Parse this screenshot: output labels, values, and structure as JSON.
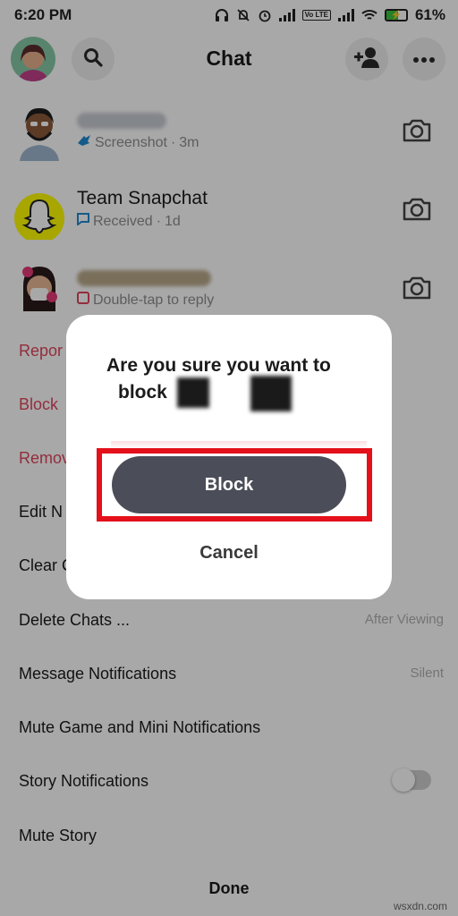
{
  "status_bar": {
    "time": "6:20 PM",
    "battery": "61%",
    "volte": "Vo LTE"
  },
  "header": {
    "title": "Chat"
  },
  "chats": [
    {
      "name": "",
      "status": "Screenshot",
      "time": "3m"
    },
    {
      "name": "Team Snapchat",
      "status": "Received",
      "time": "1d"
    },
    {
      "name": "",
      "status": "Double-tap to reply",
      "time": ""
    }
  ],
  "sheet": {
    "items": [
      {
        "label": "Repor"
      },
      {
        "label": "Block"
      },
      {
        "label": "Remov"
      },
      {
        "label": "Edit N"
      },
      {
        "label": "Clear C"
      },
      {
        "label": "Delete Chats ...",
        "value": "After Viewing"
      },
      {
        "label": "Message Notifications",
        "value": "Silent"
      },
      {
        "label": "Mute Game and Mini Notifications"
      },
      {
        "label": "Story Notifications"
      },
      {
        "label": "Mute Story"
      }
    ],
    "done_label": "Done"
  },
  "dialog": {
    "line1": "Are you sure you want to",
    "line2": "block",
    "confirm_label": "Block",
    "cancel_label": "Cancel"
  },
  "colors": {
    "accent_red": "#e4101b",
    "menu_red": "#e0455c",
    "button_dark": "#4b4e58"
  },
  "watermark": "wsxdn.com"
}
